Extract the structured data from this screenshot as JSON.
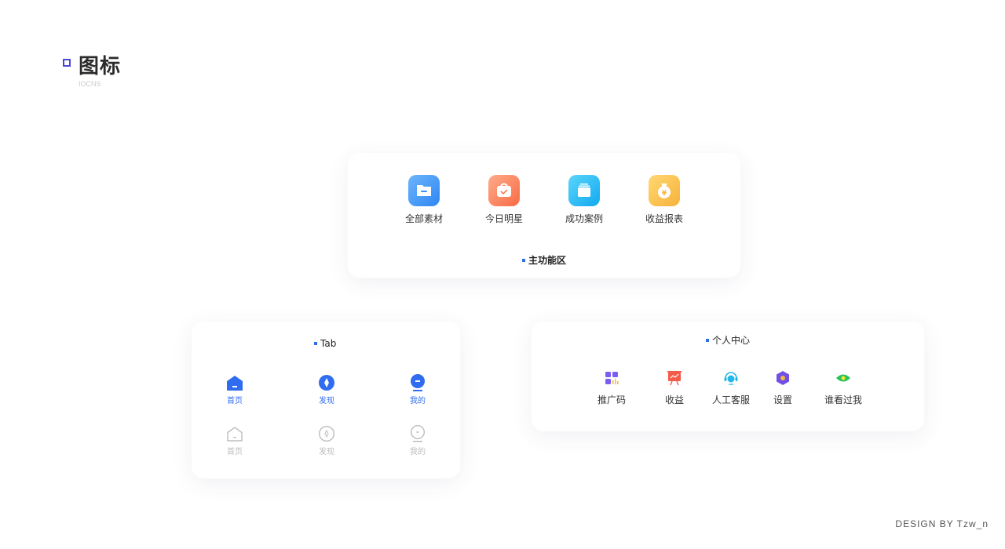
{
  "header": {
    "title": "图标",
    "subtitle": "IOCNS"
  },
  "main_area": {
    "title": "主功能区",
    "items": [
      {
        "label": "全部素材",
        "icon": "folder-icon",
        "color": "#3b8ef5"
      },
      {
        "label": "今日明星",
        "icon": "bag-check-icon",
        "color": "#fb7c57"
      },
      {
        "label": "成功案例",
        "icon": "stack-icon",
        "color": "#1fb6f3"
      },
      {
        "label": "收益报表",
        "icon": "money-bag-icon",
        "color": "#fbbd47"
      }
    ]
  },
  "tab_area": {
    "title": "Tab",
    "active": [
      {
        "label": "首页",
        "icon": "home-icon"
      },
      {
        "label": "发现",
        "icon": "compass-icon"
      },
      {
        "label": "我的",
        "icon": "profile-icon"
      }
    ],
    "inactive": [
      {
        "label": "首页",
        "icon": "home-outline-icon"
      },
      {
        "label": "发现",
        "icon": "compass-outline-icon"
      },
      {
        "label": "我的",
        "icon": "profile-outline-icon"
      }
    ],
    "active_color": "#2f6cf0",
    "inactive_color": "#bdbdbd"
  },
  "profile_area": {
    "title": "个人中心",
    "items": [
      {
        "label": "推广码",
        "icon": "qr-code-icon",
        "color": "#7b5cf5"
      },
      {
        "label": "收益",
        "icon": "earnings-board-icon",
        "color": "#f45b4b"
      },
      {
        "label": "人工客服",
        "icon": "headset-icon",
        "color": "#23b8e8"
      },
      {
        "label": "设置",
        "icon": "settings-hex-icon",
        "color": "#7150e8"
      },
      {
        "label": "谁看过我",
        "icon": "eye-icon",
        "color": "#22c45a"
      }
    ]
  },
  "footer": {
    "credit": "DESIGN BY Tzw_n"
  }
}
